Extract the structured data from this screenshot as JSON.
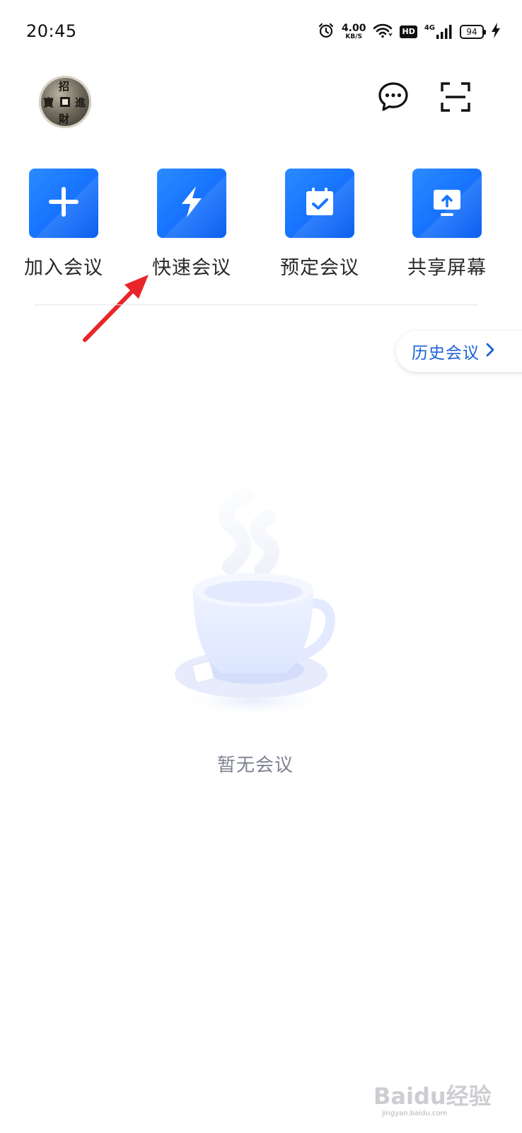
{
  "status_bar": {
    "time": "20:45",
    "net_speed_value": "4.00",
    "net_speed_unit": "KB/S",
    "hd_label": "HD",
    "network_type": "4G",
    "battery_level": "94",
    "icons": [
      "alarm-icon",
      "wifi-icon",
      "hd-icon",
      "signal-4g-icon",
      "battery-icon",
      "charging-icon"
    ]
  },
  "header": {
    "avatar_glyphs": [
      "招",
      "進",
      "寶",
      "財"
    ],
    "right_icons": [
      "message-icon",
      "scan-icon"
    ]
  },
  "actions": [
    {
      "label": "加入会议",
      "icon": "plus-icon"
    },
    {
      "label": "快速会议",
      "icon": "lightning-icon"
    },
    {
      "label": "预定会议",
      "icon": "calendar-check-icon"
    },
    {
      "label": "共享屏幕",
      "icon": "screen-share-icon"
    }
  ],
  "history": {
    "label": "历史会议",
    "icon": "chevron-right-icon"
  },
  "empty_state": {
    "text": "暂无会议",
    "illustration": "coffee-cup-illustration"
  },
  "watermark": {
    "main": "Baidu经验",
    "sub": "jingyan.baidu.com"
  },
  "colors": {
    "accent": "#1976ff",
    "history_text": "#1a62d6",
    "annotation_arrow": "#e8262a",
    "empty_text": "#7d8291"
  }
}
